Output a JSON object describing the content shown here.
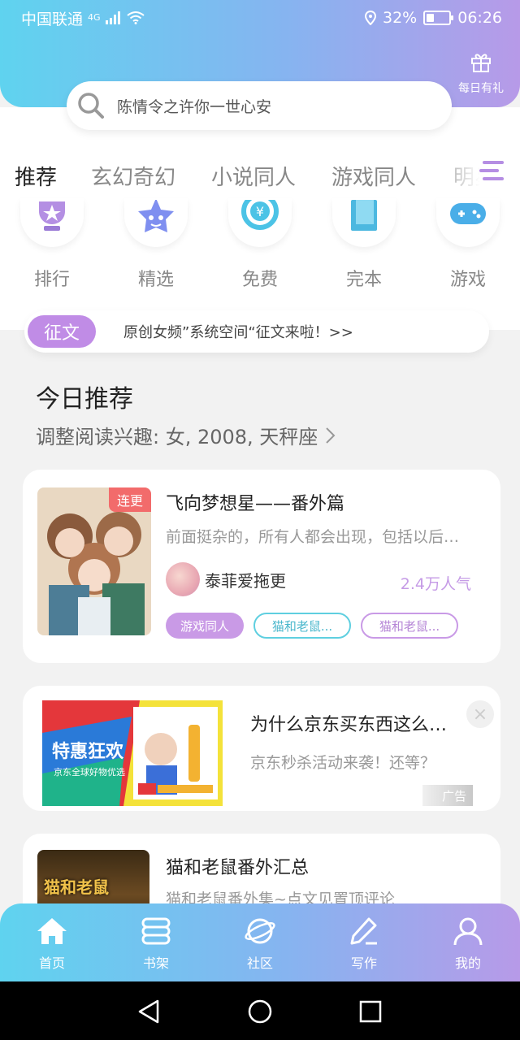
{
  "status_bar": {
    "carrier": "中国联通",
    "network": "4G",
    "battery": "32%",
    "battery_level": 0.32,
    "time": "06:26"
  },
  "header": {
    "gift_label": "每日有礼"
  },
  "search": {
    "placeholder": "陈情令之许你一世心安"
  },
  "tabs": [
    "推荐",
    "玄幻奇幻",
    "小说同人",
    "游戏同人",
    "明星"
  ],
  "categories": [
    "排行",
    "精选",
    "免费",
    "完本",
    "游戏"
  ],
  "notice": {
    "badge": "征文",
    "text": "原创女频”系统空间“征文来啦！>>"
  },
  "section": {
    "title": "今日推荐",
    "subtitle": "调整阅读兴趣: 女, 2008, 天秤座"
  },
  "book1": {
    "tag": "连更",
    "title": "飞向梦想星——番外篇",
    "desc": "前面挺杂的，所有人都会出现，包括以后…",
    "author": "泰菲爱拖更",
    "popularity": "2.4万人气",
    "chips": [
      "游戏同人",
      "猫和老鼠...",
      "猫和老鼠..."
    ]
  },
  "ad": {
    "image_title": "特惠狂欢",
    "image_sub": "京东全球好物优选",
    "title": "为什么京东买东西这么…",
    "desc": "京东秒杀活动来袭！还等？",
    "tag": "广告",
    "close": "×"
  },
  "book2": {
    "cover_text": "猫和老鼠",
    "title": "猫和老鼠番外汇总",
    "desc": "猫和老鼠番外集~点文见置顶评论"
  },
  "bottom_nav": [
    "首页",
    "书架",
    "社区",
    "写作",
    "我的"
  ]
}
